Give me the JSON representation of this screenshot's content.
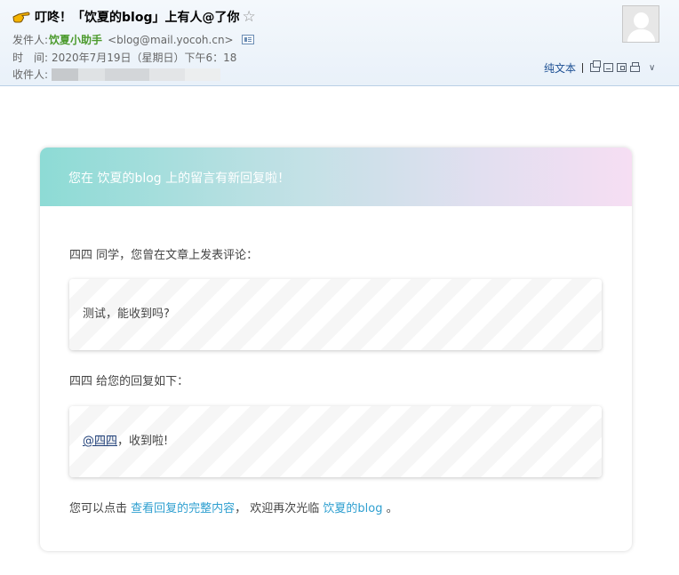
{
  "header": {
    "subject": "叮咚！「饮夏的blog」上有人@了你",
    "sender_label": "发件人:",
    "sender_name": "饮夏小助手",
    "sender_email": "<blog@mail.yocoh.cn>",
    "time_label": "时　间:",
    "time_value": "2020年7月19日（星期日）下午6：18",
    "recipient_label": "收件人:",
    "plain_text_label": "纯文本"
  },
  "email": {
    "heading": "您在 饮夏的blog 上的留言有新回复啦！",
    "intro": "四四 同学，您曾在文章上发表评论：",
    "original_comment": "测试，能收到吗?",
    "reply_intro": "四四 给您的回复如下：",
    "reply_mention": "@四四",
    "reply_text": "，收到啦!",
    "footer_prefix": "您可以点击 ",
    "footer_link": "查看回复的完整内容",
    "footer_middle": "， 欢迎再次光临 ",
    "footer_site": "饮夏的blog",
    "footer_suffix": " 。"
  }
}
